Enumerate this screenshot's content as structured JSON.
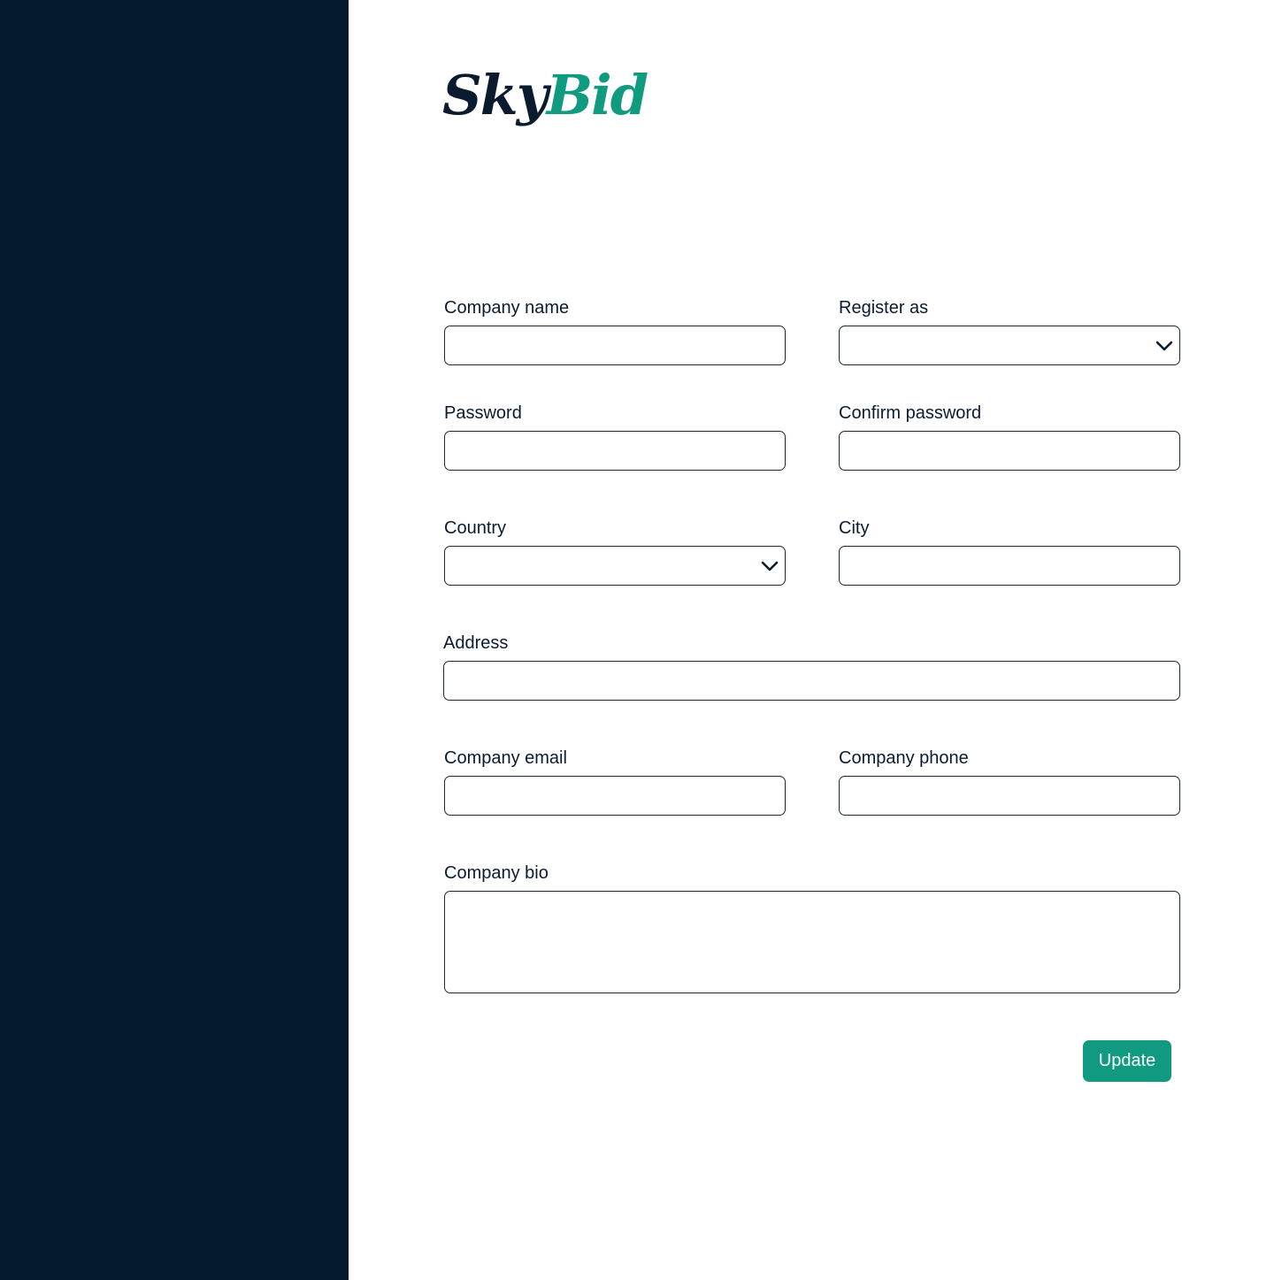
{
  "brand": {
    "logo_part_a": "Sky",
    "logo_part_b": "Bid"
  },
  "form": {
    "company_name": {
      "label": "Company name",
      "value": ""
    },
    "register_as": {
      "label": "Register as",
      "value": ""
    },
    "password": {
      "label": "Password",
      "value": ""
    },
    "confirm_password": {
      "label": "Confirm password",
      "value": ""
    },
    "country": {
      "label": "Country",
      "value": ""
    },
    "city": {
      "label": "City",
      "value": ""
    },
    "address": {
      "label": "Address",
      "value": ""
    },
    "company_email": {
      "label": "Company email",
      "value": ""
    },
    "company_phone": {
      "label": "Company phone",
      "value": ""
    },
    "company_bio": {
      "label": "Company bio",
      "value": ""
    }
  },
  "actions": {
    "update_label": "Update"
  },
  "colors": {
    "sidebar": "#061a2f",
    "brand_dark": "#0b1b2f",
    "accent": "#109a80"
  },
  "icons": {
    "dropdown": "chevron-down-icon"
  }
}
